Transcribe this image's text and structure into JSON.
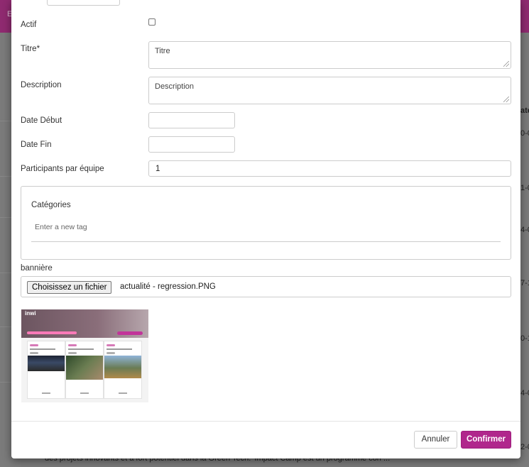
{
  "background": {
    "header_fragment": "E",
    "right_fragments": [
      "ate",
      "0-0",
      "1-0",
      "4-0",
      "7-1",
      "0-1",
      "4-0",
      "2-0"
    ],
    "bottom_text": "des projets innovants et à fort potentiel dans la Green Tech. 'Impact Camp est un programme con ..."
  },
  "form": {
    "actif_label": "Actif",
    "actif_checked": false,
    "titre_label": "Titre*",
    "titre_placeholder": "Titre",
    "description_label": "Description",
    "description_placeholder": "Description",
    "date_debut_label": "Date Début",
    "date_debut_value": "",
    "date_fin_label": "Date Fin",
    "date_fin_value": "",
    "participants_label": "Participants par équipe",
    "participants_value": "1",
    "categories_title": "Catégories",
    "tag_placeholder": "Enter a new tag",
    "banniere_label": "bannière",
    "file_button": "Choisissez un fichier",
    "file_name": "actualité - regression.PNG"
  },
  "preview": {
    "logo_text": "inwi",
    "accent_color": "#c2349a"
  },
  "footer": {
    "cancel_label": "Annuler",
    "confirm_label": "Confirmer",
    "confirm_color": "#b0278c"
  }
}
